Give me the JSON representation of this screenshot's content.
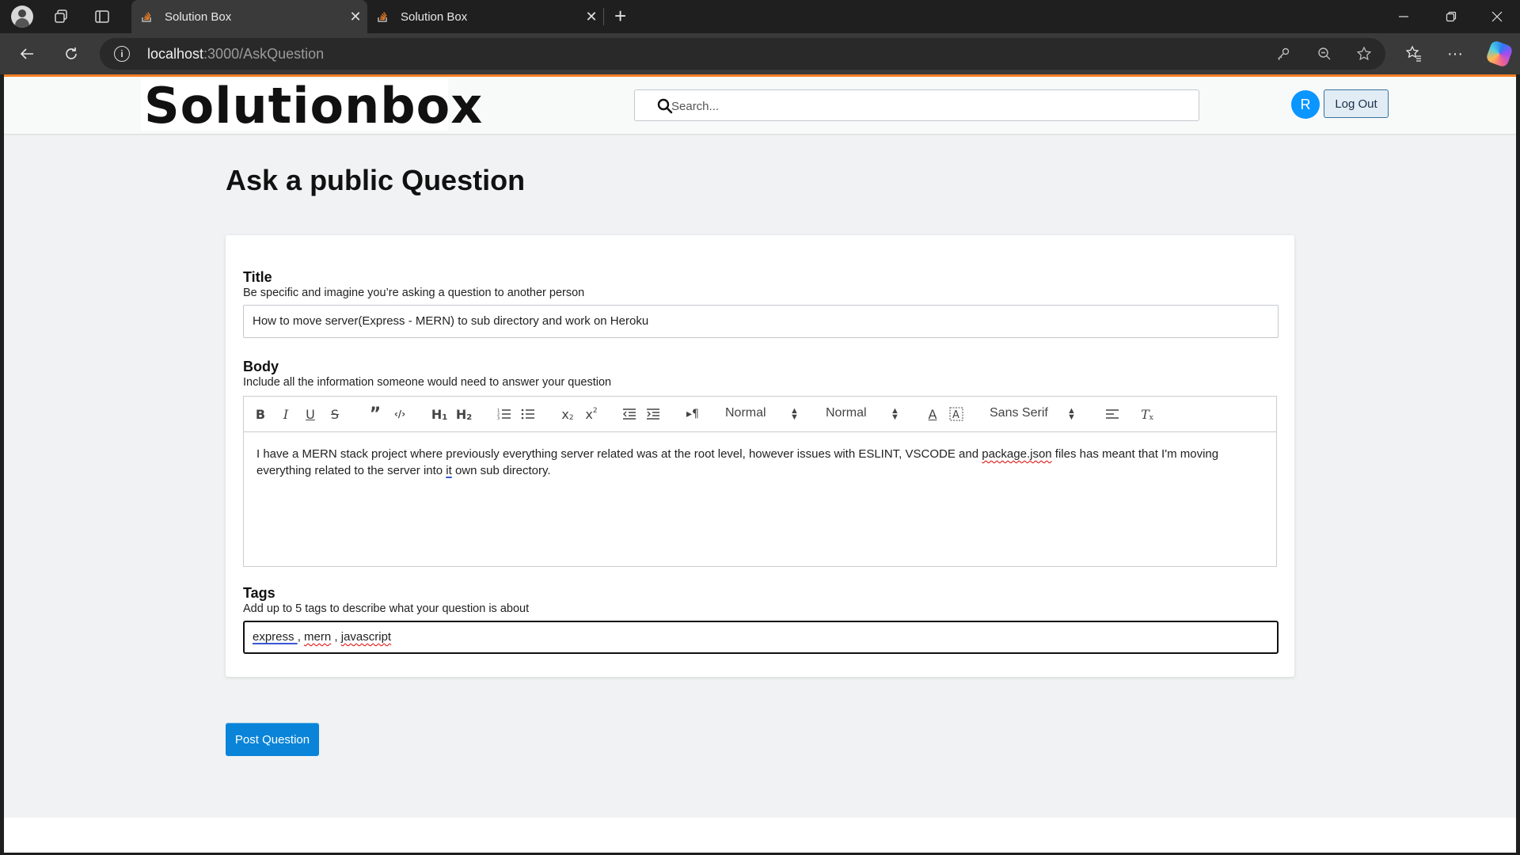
{
  "browser": {
    "tabs": [
      {
        "title": "Solution Box",
        "active": true
      },
      {
        "title": "Solution Box",
        "active": false
      }
    ],
    "url_host": "localhost",
    "url_rest": ":3000/AskQuestion"
  },
  "navbar": {
    "logo_text": "Solutionbox",
    "search_placeholder": "Search...",
    "avatar_initial": "R",
    "logout_label": "Log Out"
  },
  "page_title": "Ask a public Question",
  "form": {
    "title_label": "Title",
    "title_hint": "Be specific and imagine you’re asking a question to another person",
    "title_value": "How to move server(Express - MERN) to sub directory and work on Heroku",
    "body_label": "Body",
    "body_hint": "Include all the information someone would need to answer your question",
    "body_text": {
      "part1": "I have a MERN stack project where previously everything server related was at the root level, however issues with ESLINT, VSCODE and ",
      "spell1": "package.json",
      "part2": " files has meant that I'm moving everything related to the server into ",
      "spell2": "it",
      "part3": " own sub directory."
    },
    "toolbar": {
      "header_picker": "Normal",
      "size_picker": "Normal",
      "font_picker": "Sans Serif"
    },
    "tags_label": "Tags",
    "tags_hint": "Add up to 5 tags to describe what your question is about",
    "tags": [
      "express",
      "mern",
      "javascript"
    ]
  },
  "post_button_label": "Post Question",
  "colors": {
    "accent": "#f48024",
    "primary_button": "#0a84d8",
    "avatar": "#0a95ff"
  }
}
